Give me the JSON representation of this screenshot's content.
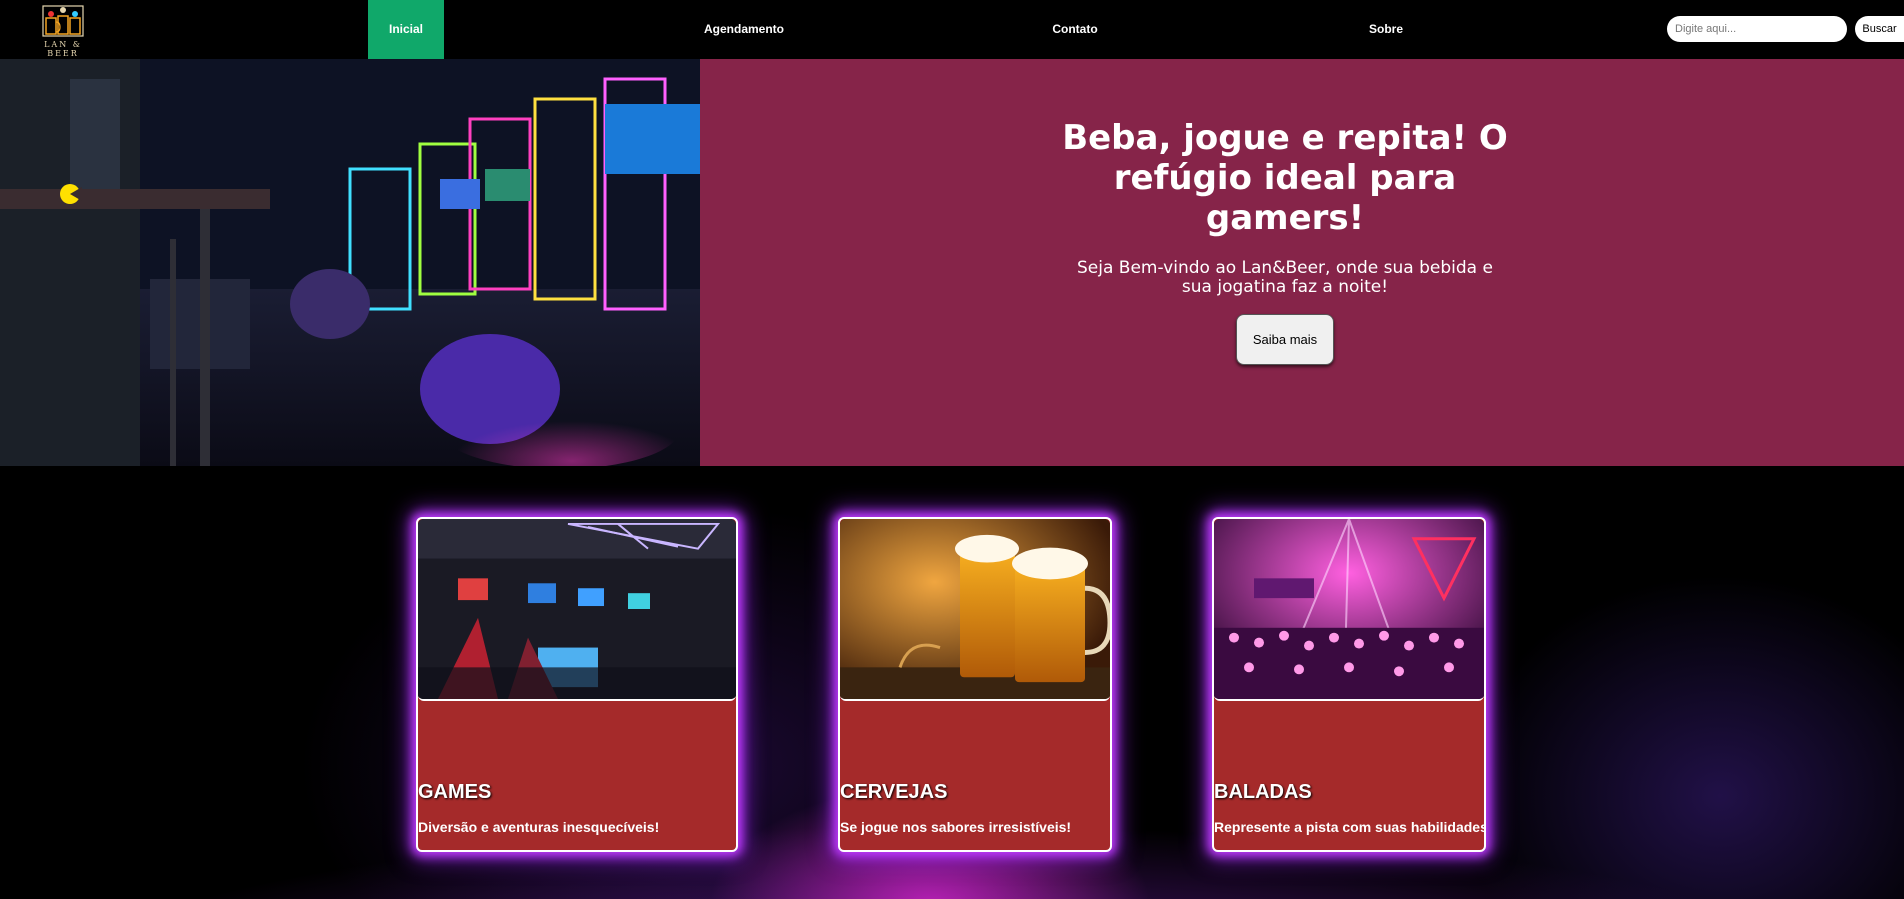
{
  "brand": {
    "logo_text": "LAN & BEER"
  },
  "nav": {
    "items": [
      {
        "label": "Inicial",
        "active": true
      },
      {
        "label": "Agendamento",
        "active": false
      },
      {
        "label": "Contato",
        "active": false
      },
      {
        "label": "Sobre",
        "active": false
      }
    ],
    "search_placeholder": "Digite aqui...",
    "search_button": "Buscar"
  },
  "hero": {
    "title": "Beba, jogue e repita! O refúgio ideal para gamers!",
    "subtitle": "Seja Bem-vindo ao Lan&Beer, onde sua bebida e sua jogatina faz a noite!",
    "button": "Saiba mais"
  },
  "cards": [
    {
      "title": "GAMES",
      "text": "Diversão e aventuras inesquecíveis!",
      "image": "lan-house-photo"
    },
    {
      "title": "CERVEJAS",
      "text": "Se jogue nos sabores irresistíveis!",
      "image": "beer-mugs-photo"
    },
    {
      "title": "BALADAS",
      "text": "Represente a pista com suas habilidades!",
      "image": "nightclub-photo"
    }
  ],
  "colors": {
    "nav_bg": "#000000",
    "active_nav": "#10a86a",
    "hero_panel": "#862449",
    "card_bg": "#a52a2a",
    "card_glow": "#c13cff"
  }
}
